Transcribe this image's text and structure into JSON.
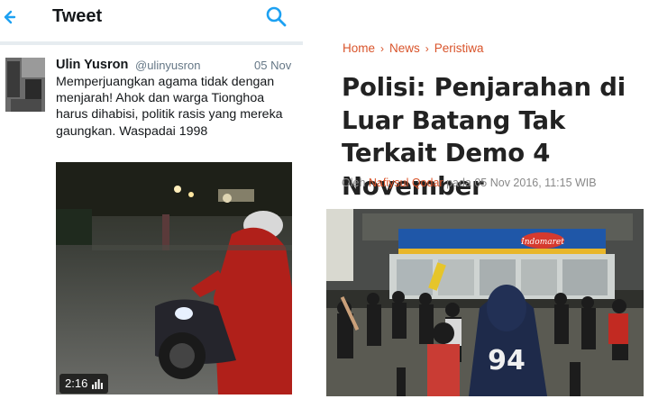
{
  "tweet": {
    "header_title": "Tweet",
    "author_name": "Ulin Yusron",
    "author_handle": "@ulinyusron",
    "date": "05 Nov",
    "text": "Memperjuangkan agama tidak dengan menjarah! Ahok dan warga Tionghoa harus dihabisi, politik rasis yang mereka gaungkan. Waspadai 1998",
    "video_duration": "2:16",
    "icons": [
      "back-icon",
      "search-icon",
      "video-bars-icon"
    ]
  },
  "article": {
    "breadcrumb": [
      "Home",
      "News",
      "Peristiwa"
    ],
    "headline": "Polisi: Penjarahan di Luar Batang Tak Terkait Demo 4 November",
    "byline_prefix": "Oleh",
    "byline_author": "Nafiysul Qodar",
    "byline_suffix": "pada 05 Nov 2016, 11:15 WIB",
    "store_sign": "Indomaret",
    "jersey_number": "94"
  },
  "colors": {
    "twitter_blue": "#1da1f2",
    "accent_orange": "#d9542b"
  }
}
